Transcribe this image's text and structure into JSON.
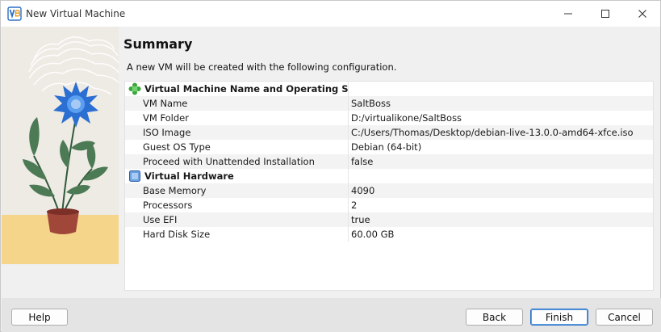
{
  "window": {
    "title": "New Virtual Machine"
  },
  "page": {
    "title": "Summary",
    "description": "A new VM will be created with the following configuration."
  },
  "sections": [
    {
      "title": "Virtual Machine Name and Operating System",
      "icon": "green-puzzle-icon",
      "rows": [
        {
          "key": "VM Name",
          "value": "SaltBoss"
        },
        {
          "key": "VM Folder",
          "value": "D:/virtualikone/SaltBoss"
        },
        {
          "key": "ISO Image",
          "value": "C:/Users/Thomas/Desktop/debian-live-13.0.0-amd64-xfce.iso"
        },
        {
          "key": "Guest OS Type",
          "value": "Debian (64-bit)"
        },
        {
          "key": "Proceed with Unattended Installation",
          "value": "false"
        }
      ]
    },
    {
      "title": "Virtual Hardware",
      "icon": "chip-icon",
      "rows": [
        {
          "key": "Base Memory",
          "value": "4090"
        },
        {
          "key": "Processors",
          "value": "2"
        },
        {
          "key": "Use EFI",
          "value": "true"
        },
        {
          "key": "Hard Disk Size",
          "value": "60.00 GB"
        }
      ]
    }
  ],
  "buttons": {
    "help": "Help",
    "back": "Back",
    "finish": "Finish",
    "cancel": "Cancel"
  },
  "colors": {
    "accent": "#2a72c8",
    "alt_row": "#f3f3f3",
    "bottombar": "#e4e4e4"
  }
}
